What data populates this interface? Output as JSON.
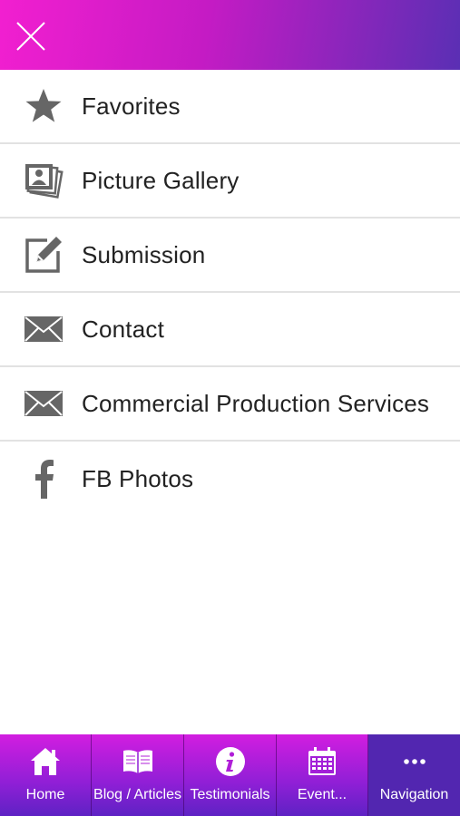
{
  "header": {
    "close_icon": "close-icon",
    "gradient": [
      "#f21fd0",
      "#c41bc4",
      "#5a2fb4"
    ]
  },
  "menu": {
    "items": [
      {
        "label": "Favorites",
        "icon": "star-icon"
      },
      {
        "label": "Picture Gallery",
        "icon": "photo-stack-icon"
      },
      {
        "label": "Submission",
        "icon": "edit-icon"
      },
      {
        "label": "Contact",
        "icon": "envelope-icon"
      },
      {
        "label": "Commercial Production Services",
        "icon": "envelope-icon"
      },
      {
        "label": "FB Photos",
        "icon": "facebook-icon"
      }
    ],
    "icon_color": "#666666",
    "text_color": "#222222"
  },
  "tabbar": {
    "tabs": [
      {
        "label": "Home",
        "icon": "home-icon"
      },
      {
        "label": "Blog / Articles",
        "icon": "book-icon"
      },
      {
        "label": "Testimonials",
        "icon": "info-icon"
      },
      {
        "label": "Event...",
        "icon": "calendar-icon"
      },
      {
        "label": "Navigation",
        "icon": "more-icon",
        "active": true
      }
    ],
    "active_color": "#5226b0"
  }
}
